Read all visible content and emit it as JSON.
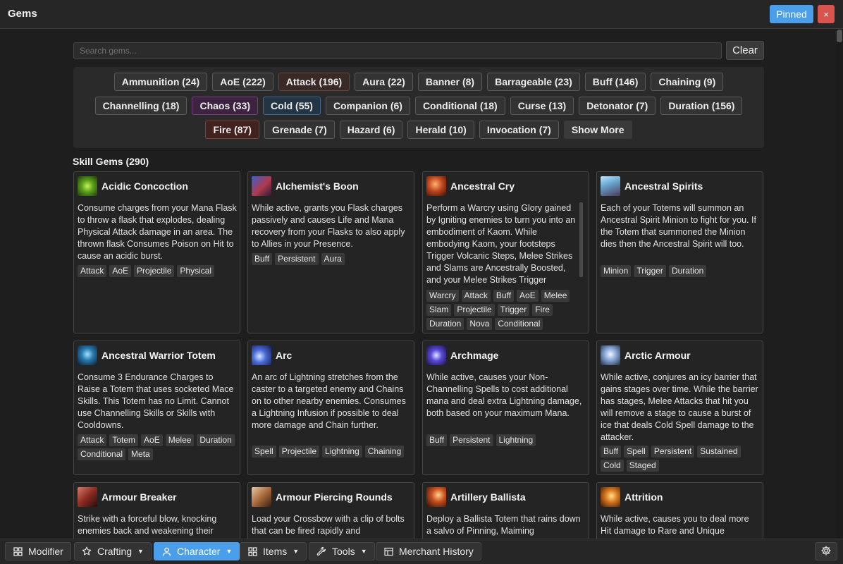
{
  "window": {
    "title": "Gems",
    "pinned_label": "Pinned",
    "close_label": "×"
  },
  "search": {
    "placeholder": "Search gems...",
    "clear_label": "Clear"
  },
  "filters": {
    "row1": [
      "Ammunition (24)",
      "AoE (222)",
      "Attack (196)",
      "Aura (22)",
      "Banner (8)",
      "Barrageable (23)",
      "Buff (146)",
      "Chaining (9)"
    ],
    "row2": [
      "Channelling (18)",
      "Chaos (33)",
      "Cold (55)",
      "Companion (6)",
      "Conditional (18)",
      "Curse (13)",
      "Detonator (7)",
      "Duration (156)"
    ],
    "row3": [
      "Fire (87)",
      "Grenade (7)",
      "Hazard (6)",
      "Herald (10)",
      "Invocation (7)"
    ],
    "show_more": "Show More"
  },
  "section": {
    "title": "Skill Gems (290)"
  },
  "gems": [
    {
      "name": "Acidic Concoction",
      "desc": "Consume charges from your Mana Flask to throw a flask that explodes, dealing Physical Attack damage in an area. The thrown flask Consumes Poison on Hit to cause an acidic burst.",
      "tags": [
        "Attack",
        "AoE",
        "Projectile",
        "Physical"
      ]
    },
    {
      "name": "Alchemist's Boon",
      "desc": "While active, grants you Flask charges passively and causes Life and Mana recovery from your Flasks to also apply to Allies in your Presence.",
      "tags": [
        "Buff",
        "Persistent",
        "Aura"
      ]
    },
    {
      "name": "Ancestral Cry",
      "desc": "Perform a Warcry using Glory gained by Igniting enemies to turn you into an embodiment of Kaom. While embodying Kaom, your footsteps Trigger Volcanic Steps, Melee Strikes and Slams are Ancestrally Boosted, and your Melee Strikes Trigger",
      "tags": [
        "Warcry",
        "Attack",
        "Buff",
        "AoE",
        "Melee",
        "Slam",
        "Projectile",
        "Trigger",
        "Fire",
        "Duration",
        "Nova",
        "Conditional"
      ]
    },
    {
      "name": "Ancestral Spirits",
      "desc": "Each of your Totems will summon an Ancestral Spirit Minion to fight for you. If the Totem that summoned the Minion dies then the Ancestral Spirit will too.",
      "tags": [
        "Minion",
        "Trigger",
        "Duration"
      ]
    },
    {
      "name": "Ancestral Warrior Totem",
      "desc": "Consume 3 Endurance Charges to Raise a Totem that uses socketed Mace Skills. This Totem has no Limit. Cannot use Channelling Skills or Skills with Cooldowns.",
      "tags": [
        "Attack",
        "Totem",
        "AoE",
        "Melee",
        "Duration",
        "Conditional",
        "Meta"
      ]
    },
    {
      "name": "Arc",
      "desc": "An arc of Lightning stretches from the caster to a targeted enemy and Chains on to other nearby enemies. Consumes a Lightning Infusion if possible to deal more damage and Chain further.",
      "tags": [
        "Spell",
        "Projectile",
        "Lightning",
        "Chaining"
      ]
    },
    {
      "name": "Archmage",
      "desc": "While active, causes your Non-Channelling Spells to cost additional mana and deal extra Lightning damage, both based on your maximum Mana.",
      "tags": [
        "Buff",
        "Persistent",
        "Lightning"
      ]
    },
    {
      "name": "Arctic Armour",
      "desc": "While active, conjures an icy barrier that gains stages over time. While the barrier has stages, Melee Attacks that hit you will remove a stage to cause a burst of ice that deals Cold Spell damage to the attacker.",
      "tags": [
        "Buff",
        "Spell",
        "Persistent",
        "Sustained",
        "Cold",
        "Staged"
      ]
    },
    {
      "name": "Armour Breaker",
      "desc": "Strike with a forceful blow, knocking enemies back and weakening their",
      "tags": []
    },
    {
      "name": "Armour Piercing Rounds",
      "desc": "Load your Crossbow with a clip of bolts that can be fired rapidly and",
      "tags": []
    },
    {
      "name": "Artillery Ballista",
      "desc": "Deploy a Ballista Totem that rains down a salvo of Pinning, Maiming",
      "tags": []
    },
    {
      "name": "Attrition",
      "desc": "While active, causes you to deal more Hit damage to Rare and Unique",
      "tags": []
    }
  ],
  "bottom_nav": {
    "modifier": "Modifier",
    "crafting": "Crafting",
    "character": "Character",
    "items": "Items",
    "tools": "Tools",
    "merchant": "Merchant History"
  }
}
